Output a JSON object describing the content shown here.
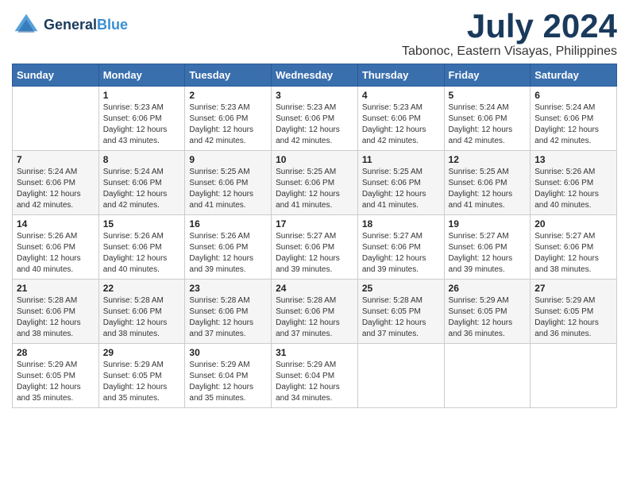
{
  "header": {
    "logo_line1": "General",
    "logo_line2": "Blue",
    "month_year": "July 2024",
    "location": "Tabonoc, Eastern Visayas, Philippines"
  },
  "days_of_week": [
    "Sunday",
    "Monday",
    "Tuesday",
    "Wednesday",
    "Thursday",
    "Friday",
    "Saturday"
  ],
  "weeks": [
    [
      {
        "day": "",
        "sunrise": "",
        "sunset": "",
        "daylight": ""
      },
      {
        "day": "1",
        "sunrise": "Sunrise: 5:23 AM",
        "sunset": "Sunset: 6:06 PM",
        "daylight": "Daylight: 12 hours and 43 minutes."
      },
      {
        "day": "2",
        "sunrise": "Sunrise: 5:23 AM",
        "sunset": "Sunset: 6:06 PM",
        "daylight": "Daylight: 12 hours and 42 minutes."
      },
      {
        "day": "3",
        "sunrise": "Sunrise: 5:23 AM",
        "sunset": "Sunset: 6:06 PM",
        "daylight": "Daylight: 12 hours and 42 minutes."
      },
      {
        "day": "4",
        "sunrise": "Sunrise: 5:23 AM",
        "sunset": "Sunset: 6:06 PM",
        "daylight": "Daylight: 12 hours and 42 minutes."
      },
      {
        "day": "5",
        "sunrise": "Sunrise: 5:24 AM",
        "sunset": "Sunset: 6:06 PM",
        "daylight": "Daylight: 12 hours and 42 minutes."
      },
      {
        "day": "6",
        "sunrise": "Sunrise: 5:24 AM",
        "sunset": "Sunset: 6:06 PM",
        "daylight": "Daylight: 12 hours and 42 minutes."
      }
    ],
    [
      {
        "day": "7",
        "sunrise": "Sunrise: 5:24 AM",
        "sunset": "Sunset: 6:06 PM",
        "daylight": "Daylight: 12 hours and 42 minutes."
      },
      {
        "day": "8",
        "sunrise": "Sunrise: 5:24 AM",
        "sunset": "Sunset: 6:06 PM",
        "daylight": "Daylight: 12 hours and 42 minutes."
      },
      {
        "day": "9",
        "sunrise": "Sunrise: 5:25 AM",
        "sunset": "Sunset: 6:06 PM",
        "daylight": "Daylight: 12 hours and 41 minutes."
      },
      {
        "day": "10",
        "sunrise": "Sunrise: 5:25 AM",
        "sunset": "Sunset: 6:06 PM",
        "daylight": "Daylight: 12 hours and 41 minutes."
      },
      {
        "day": "11",
        "sunrise": "Sunrise: 5:25 AM",
        "sunset": "Sunset: 6:06 PM",
        "daylight": "Daylight: 12 hours and 41 minutes."
      },
      {
        "day": "12",
        "sunrise": "Sunrise: 5:25 AM",
        "sunset": "Sunset: 6:06 PM",
        "daylight": "Daylight: 12 hours and 41 minutes."
      },
      {
        "day": "13",
        "sunrise": "Sunrise: 5:26 AM",
        "sunset": "Sunset: 6:06 PM",
        "daylight": "Daylight: 12 hours and 40 minutes."
      }
    ],
    [
      {
        "day": "14",
        "sunrise": "Sunrise: 5:26 AM",
        "sunset": "Sunset: 6:06 PM",
        "daylight": "Daylight: 12 hours and 40 minutes."
      },
      {
        "day": "15",
        "sunrise": "Sunrise: 5:26 AM",
        "sunset": "Sunset: 6:06 PM",
        "daylight": "Daylight: 12 hours and 40 minutes."
      },
      {
        "day": "16",
        "sunrise": "Sunrise: 5:26 AM",
        "sunset": "Sunset: 6:06 PM",
        "daylight": "Daylight: 12 hours and 39 minutes."
      },
      {
        "day": "17",
        "sunrise": "Sunrise: 5:27 AM",
        "sunset": "Sunset: 6:06 PM",
        "daylight": "Daylight: 12 hours and 39 minutes."
      },
      {
        "day": "18",
        "sunrise": "Sunrise: 5:27 AM",
        "sunset": "Sunset: 6:06 PM",
        "daylight": "Daylight: 12 hours and 39 minutes."
      },
      {
        "day": "19",
        "sunrise": "Sunrise: 5:27 AM",
        "sunset": "Sunset: 6:06 PM",
        "daylight": "Daylight: 12 hours and 39 minutes."
      },
      {
        "day": "20",
        "sunrise": "Sunrise: 5:27 AM",
        "sunset": "Sunset: 6:06 PM",
        "daylight": "Daylight: 12 hours and 38 minutes."
      }
    ],
    [
      {
        "day": "21",
        "sunrise": "Sunrise: 5:28 AM",
        "sunset": "Sunset: 6:06 PM",
        "daylight": "Daylight: 12 hours and 38 minutes."
      },
      {
        "day": "22",
        "sunrise": "Sunrise: 5:28 AM",
        "sunset": "Sunset: 6:06 PM",
        "daylight": "Daylight: 12 hours and 38 minutes."
      },
      {
        "day": "23",
        "sunrise": "Sunrise: 5:28 AM",
        "sunset": "Sunset: 6:06 PM",
        "daylight": "Daylight: 12 hours and 37 minutes."
      },
      {
        "day": "24",
        "sunrise": "Sunrise: 5:28 AM",
        "sunset": "Sunset: 6:06 PM",
        "daylight": "Daylight: 12 hours and 37 minutes."
      },
      {
        "day": "25",
        "sunrise": "Sunrise: 5:28 AM",
        "sunset": "Sunset: 6:05 PM",
        "daylight": "Daylight: 12 hours and 37 minutes."
      },
      {
        "day": "26",
        "sunrise": "Sunrise: 5:29 AM",
        "sunset": "Sunset: 6:05 PM",
        "daylight": "Daylight: 12 hours and 36 minutes."
      },
      {
        "day": "27",
        "sunrise": "Sunrise: 5:29 AM",
        "sunset": "Sunset: 6:05 PM",
        "daylight": "Daylight: 12 hours and 36 minutes."
      }
    ],
    [
      {
        "day": "28",
        "sunrise": "Sunrise: 5:29 AM",
        "sunset": "Sunset: 6:05 PM",
        "daylight": "Daylight: 12 hours and 35 minutes."
      },
      {
        "day": "29",
        "sunrise": "Sunrise: 5:29 AM",
        "sunset": "Sunset: 6:05 PM",
        "daylight": "Daylight: 12 hours and 35 minutes."
      },
      {
        "day": "30",
        "sunrise": "Sunrise: 5:29 AM",
        "sunset": "Sunset: 6:04 PM",
        "daylight": "Daylight: 12 hours and 35 minutes."
      },
      {
        "day": "31",
        "sunrise": "Sunrise: 5:29 AM",
        "sunset": "Sunset: 6:04 PM",
        "daylight": "Daylight: 12 hours and 34 minutes."
      },
      {
        "day": "",
        "sunrise": "",
        "sunset": "",
        "daylight": ""
      },
      {
        "day": "",
        "sunrise": "",
        "sunset": "",
        "daylight": ""
      },
      {
        "day": "",
        "sunrise": "",
        "sunset": "",
        "daylight": ""
      }
    ]
  ]
}
